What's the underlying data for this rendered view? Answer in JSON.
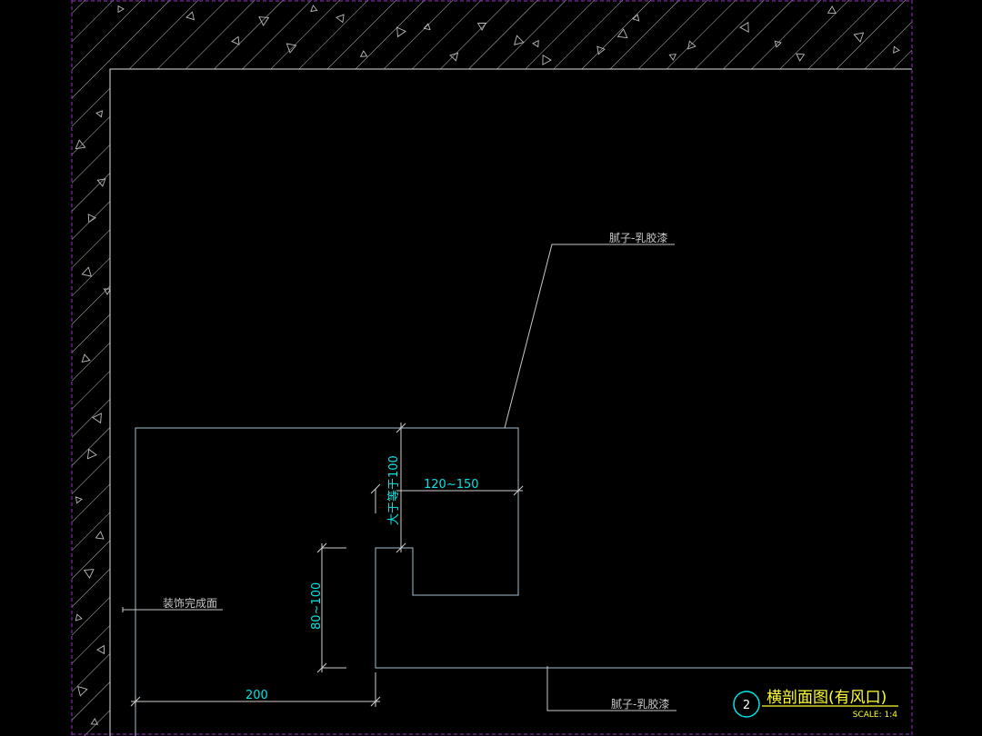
{
  "colors": {
    "background": "#000000",
    "wall_outline": "#e8e8e8",
    "hatch": "#c8c8c8",
    "frame": "#9b30c8",
    "detail_line": "#b0c8d8",
    "dimension": "#00e5e5",
    "leader_text": "#c8c8c8",
    "title": "#ffff33",
    "scale_text": "#ffff33",
    "marker_ring": "#00e5e5"
  },
  "annotations": {
    "top_leader": "腻子-乳胶漆",
    "bottom_leader": "腻子-乳胶漆",
    "finish_surface": "装饰完成面"
  },
  "dimensions": {
    "vertical_gap": "大于等于100",
    "slot_width": "120~150",
    "vertical_depth": "80~100",
    "bottom_width": "200"
  },
  "title_block": {
    "number": "2",
    "title": "横剖面图(有风口)",
    "scale": "SCALE: 1:4"
  }
}
